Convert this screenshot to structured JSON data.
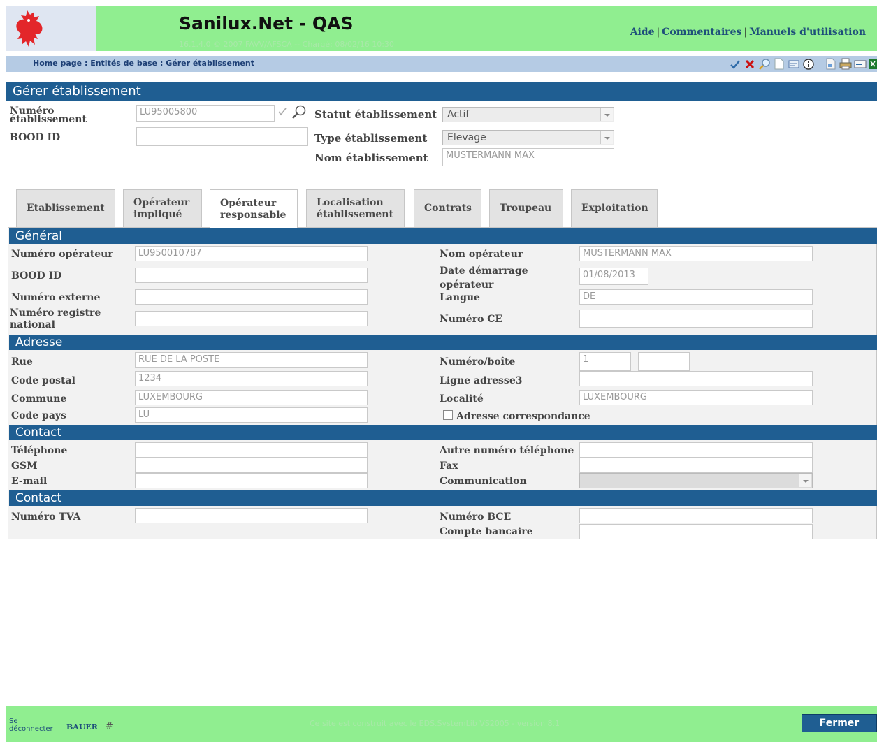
{
  "header": {
    "title": "Sanilux.Net - QAS",
    "version_line": "16.1.4.0 © 2007 FAVV/AFSCA -- Chargé: 08/02/16 10:30",
    "links": {
      "help": "Aide",
      "comments": "Commentaires",
      "manuals": "Manuels d'utilisation",
      "separator": "|"
    }
  },
  "breadcrumb": "Home page : Entités de base : Gérer établissement",
  "toolbar_icons": [
    "check-icon",
    "cancel-icon",
    "search-icon",
    "new-page-icon",
    "card-icon",
    "info-icon",
    "document-icon",
    "print-icon",
    "export-icon",
    "excel-icon"
  ],
  "establishment": {
    "section_title": "Gérer établissement",
    "number_label": "Numéro établissement",
    "number_value": "LU95005800",
    "bood_label": "BOOD ID",
    "bood_value": "",
    "status_label": "Statut établissement",
    "status_value": "Actif",
    "type_label": "Type établissement",
    "type_value": "Elevage",
    "name_label": "Nom établissement",
    "name_value": "MUSTERMANN MAX"
  },
  "tabs": [
    {
      "label": "Etablissement"
    },
    {
      "label": "Opérateur impliqué"
    },
    {
      "label": "Opérateur responsable",
      "active": true
    },
    {
      "label": "Localisation établissement"
    },
    {
      "label": "Contrats"
    },
    {
      "label": "Troupeau"
    },
    {
      "label": "Exploitation"
    }
  ],
  "general": {
    "title": "Général",
    "operator_number_label": "Numéro opérateur",
    "operator_number_value": "LU950010787",
    "bood_label": "BOOD ID",
    "bood_value": "",
    "external_label": "Numéro externe",
    "external_value": "",
    "registry_label": "Numéro registre national",
    "registry_value": "",
    "operator_name_label": "Nom opérateur",
    "operator_name_value": "MUSTERMANN MAX",
    "start_date_label": "Date démarrage opérateur",
    "start_date_value": "01/08/2013",
    "language_label": "Langue",
    "language_value": "DE",
    "ce_label": "Numéro CE",
    "ce_value": ""
  },
  "address": {
    "title": "Adresse",
    "street_label": "Rue",
    "street_value": "RUE DE LA POSTE",
    "postal_label": "Code postal",
    "postal_value": "1234",
    "commune_label": "Commune",
    "commune_value": "LUXEMBOURG",
    "country_label": "Code pays",
    "country_value": "LU",
    "number_box_label": "Numéro/boîte",
    "number_value": "1",
    "box_value": "",
    "line3_label": "Ligne adresse3",
    "line3_value": "",
    "locality_label": "Localité",
    "locality_value": "LUXEMBOURG",
    "correspondence_label": "Adresse correspondance"
  },
  "contact": {
    "title": "Contact",
    "phone_label": "Téléphone",
    "phone_value": "",
    "gsm_label": "GSM",
    "gsm_value": "",
    "email_label": "E-mail",
    "email_value": "",
    "other_phone_label": "Autre numéro téléphone",
    "other_phone_value": "",
    "fax_label": "Fax",
    "fax_value": "",
    "communication_label": "Communication",
    "communication_value": ""
  },
  "contact2": {
    "title": "Contact",
    "vat_label": "Numéro TVA",
    "vat_value": "",
    "bce_label": "Numéro BCE",
    "bce_value": "",
    "bank_label": "Compte bancaire",
    "bank_value": ""
  },
  "footer": {
    "logout": "Se déconnecter",
    "user": "BAUER",
    "hash": "#",
    "note": "Ce site est construit avec le EDS.SystemLib VS2005 - version 8.1",
    "close_label": "Fermer"
  },
  "colors": {
    "header_bg": "#90ee90",
    "breadcrumb_bg": "#b5cbe4",
    "section_bar": "#1f5e92",
    "link": "#1e4f7a"
  }
}
